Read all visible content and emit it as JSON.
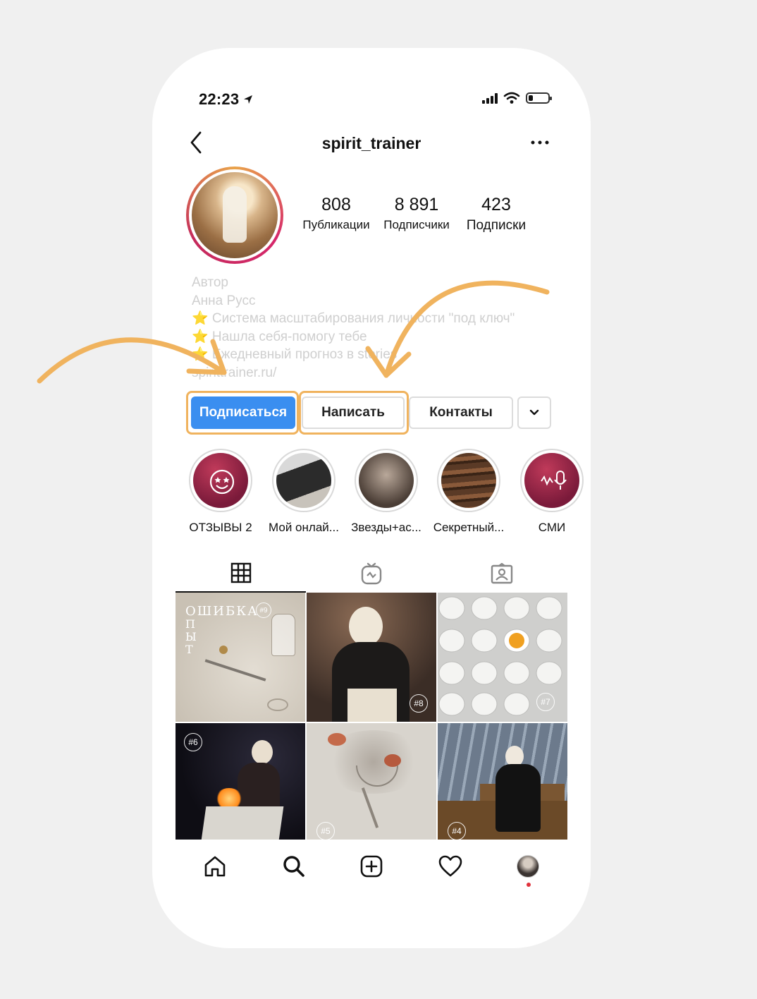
{
  "status_bar": {
    "time": "22:23"
  },
  "header": {
    "username": "spirit_trainer"
  },
  "stats": [
    {
      "value": "808",
      "label": "Публикации"
    },
    {
      "value": "8 891",
      "label": "Подписчики"
    },
    {
      "value": "423",
      "label": "Подписки"
    }
  ],
  "bio": {
    "category": "Автор",
    "name": "Анна Русс",
    "line1": "⭐ Система масштабирования личности \"под ключ\"",
    "line2": "⭐ Нашла себя-помогу тебе",
    "line3": "⭐ Ежедневный прогноз в stories",
    "link": "spirittrainer.ru/"
  },
  "buttons": {
    "follow": "Подписаться",
    "message": "Написать",
    "contacts": "Контакты"
  },
  "highlights": [
    {
      "label": "ОТЗЫВЫ 2"
    },
    {
      "label": "Мой онлай..."
    },
    {
      "label": "Звезды+ас..."
    },
    {
      "label": "Секретный..."
    },
    {
      "label": "СМИ"
    }
  ],
  "grid": {
    "tile1_text": "ОШИБКА",
    "tile1_letters": [
      "П",
      "Ы",
      "Т"
    ],
    "badges": [
      "#9",
      "#8",
      "#7",
      "#6",
      "#5",
      "#4"
    ]
  },
  "colors": {
    "primary_button": "#3a8ef0",
    "annotation": "#f0b35e",
    "notification_dot": "#e0323c"
  }
}
